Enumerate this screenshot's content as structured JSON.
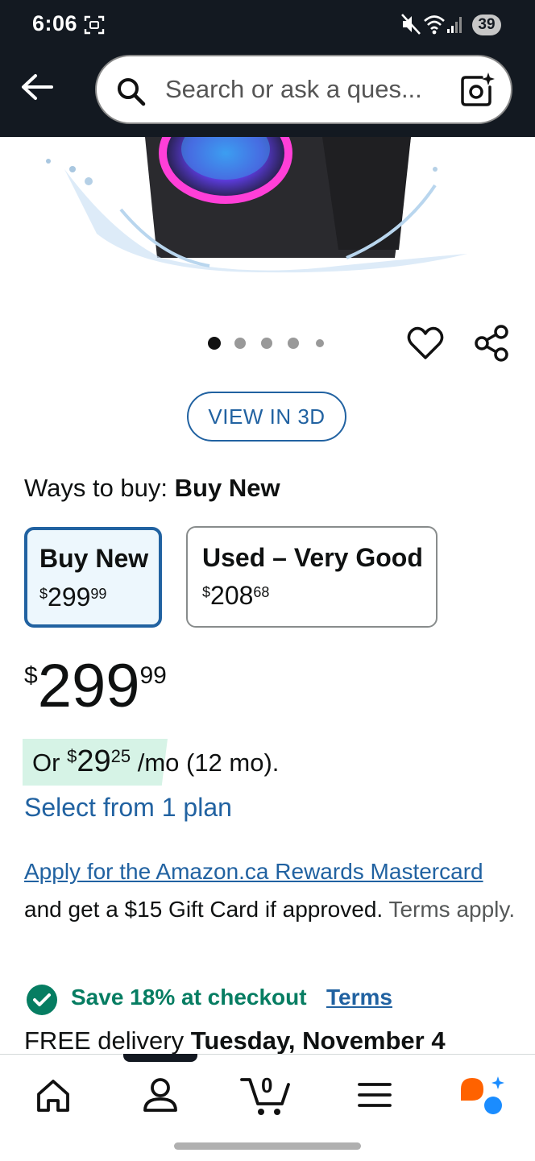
{
  "status_bar": {
    "time": "6:06",
    "battery": "39"
  },
  "header": {
    "search_placeholder": "Search or ask a ques..."
  },
  "image_carousel": {
    "total_dots": 5,
    "active_index": 0
  },
  "view_3d_label": "VIEW IN 3D",
  "ways_to_buy": {
    "label": "Ways to buy:",
    "selected": "Buy New",
    "options": [
      {
        "title": "Buy New",
        "price_whole": "299",
        "price_cents": "99",
        "currency": "$"
      },
      {
        "title": "Used – Very Good",
        "price_whole": "208",
        "price_cents": "68",
        "currency": "$"
      }
    ]
  },
  "price": {
    "currency": "$",
    "whole": "299",
    "cents": "99"
  },
  "installment": {
    "prefix": "Or",
    "currency": "$",
    "whole": "29",
    "cents": "25",
    "suffix": "/mo (12 mo)."
  },
  "plan_link": "Select from 1 plan",
  "card_offer": {
    "link": "Apply for the Amazon.ca Rewards Mastercard",
    "text": "and get a $15 Gift Card if approved.",
    "terms": "Terms apply."
  },
  "savings": {
    "text": "Save 18% at checkout",
    "terms_link": "Terms"
  },
  "delivery": {
    "prefix": "FREE delivery",
    "date": "Tuesday, November 4"
  },
  "bottom_nav": {
    "cart_count": "0"
  },
  "colors": {
    "header_bg": "#131921",
    "link": "#2162a1",
    "success": "#067d62",
    "selected_card_bg": "#edf7fd",
    "install_bg": "#d6f3e6",
    "rufus_orange": "#ff6200",
    "rufus_blue": "#1a8cff"
  },
  "icons": [
    "back-arrow-icon",
    "search-icon",
    "camera-icon",
    "heart-icon",
    "share-icon",
    "check-circle-icon",
    "home-icon",
    "account-icon",
    "cart-icon",
    "menu-icon",
    "rufus-icon"
  ]
}
